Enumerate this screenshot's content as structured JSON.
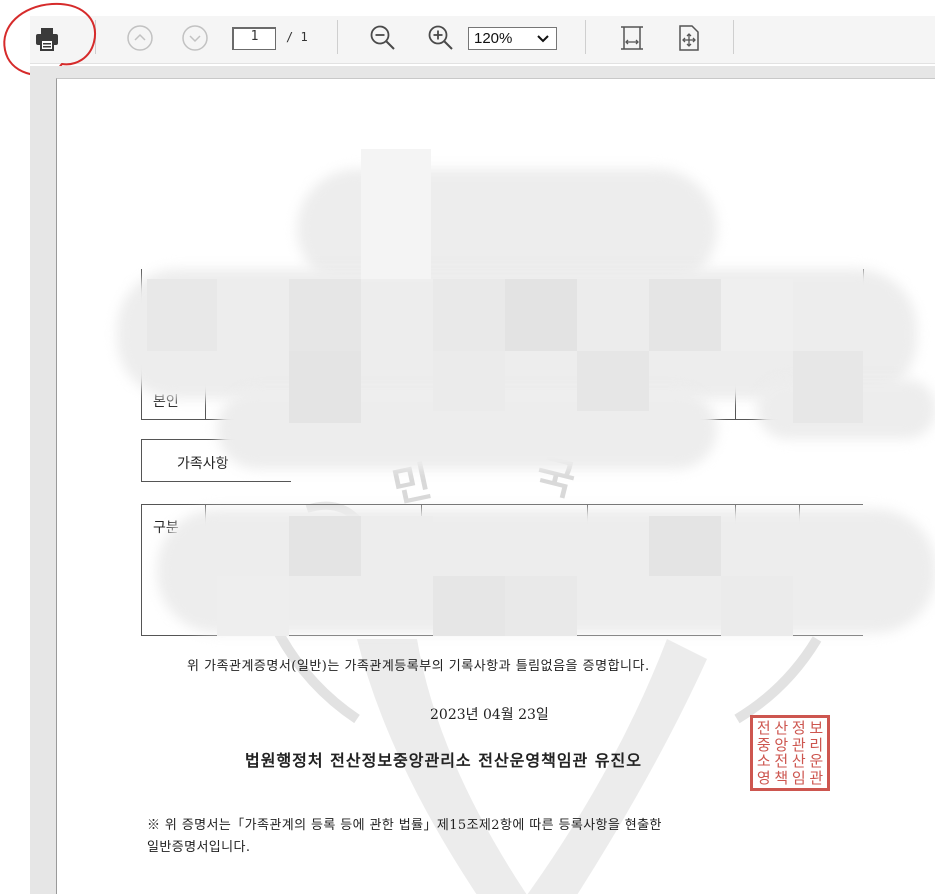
{
  "toolbar": {
    "page_current": "1",
    "page_total": "/ 1",
    "zoom_value": "120%",
    "zoom_caret": "⌄",
    "icons": {
      "print": "printer-icon",
      "prev": "chevron-up-icon",
      "next": "chevron-down-icon",
      "zoom_out": "zoom-out-icon",
      "zoom_in": "zoom-in-icon",
      "fit_width": "fit-width-icon",
      "fit_page": "fit-page-icon"
    },
    "annotation_color": "#d62b2b"
  },
  "document": {
    "table_label_name": "본인",
    "section_family": "가족사항",
    "table_label_kind": "구분",
    "certify_text": "위 가족관계증명서(일반)는 가족관계등록부의 기록사항과 틀림없음을 증명합니다.",
    "date": "2023년 04월 23일",
    "issuer": "법원행정처 전산정보중앙관리소 전산운영책임관 유진오",
    "seal_chars": [
      "전",
      "산",
      "정",
      "보",
      "중",
      "앙",
      "관",
      "리",
      "소",
      "전",
      "산",
      "운",
      "영",
      "책",
      "임",
      "관"
    ],
    "note_line1": "※ 위 증명서는「가족관계의 등록 등에 관한 법률」제15조제2항에 따른 등록사항을 현출한",
    "note_line2": "일반증명서입니다.",
    "watermark": [
      "민",
      "국"
    ],
    "seal_color": "#c8443c"
  }
}
